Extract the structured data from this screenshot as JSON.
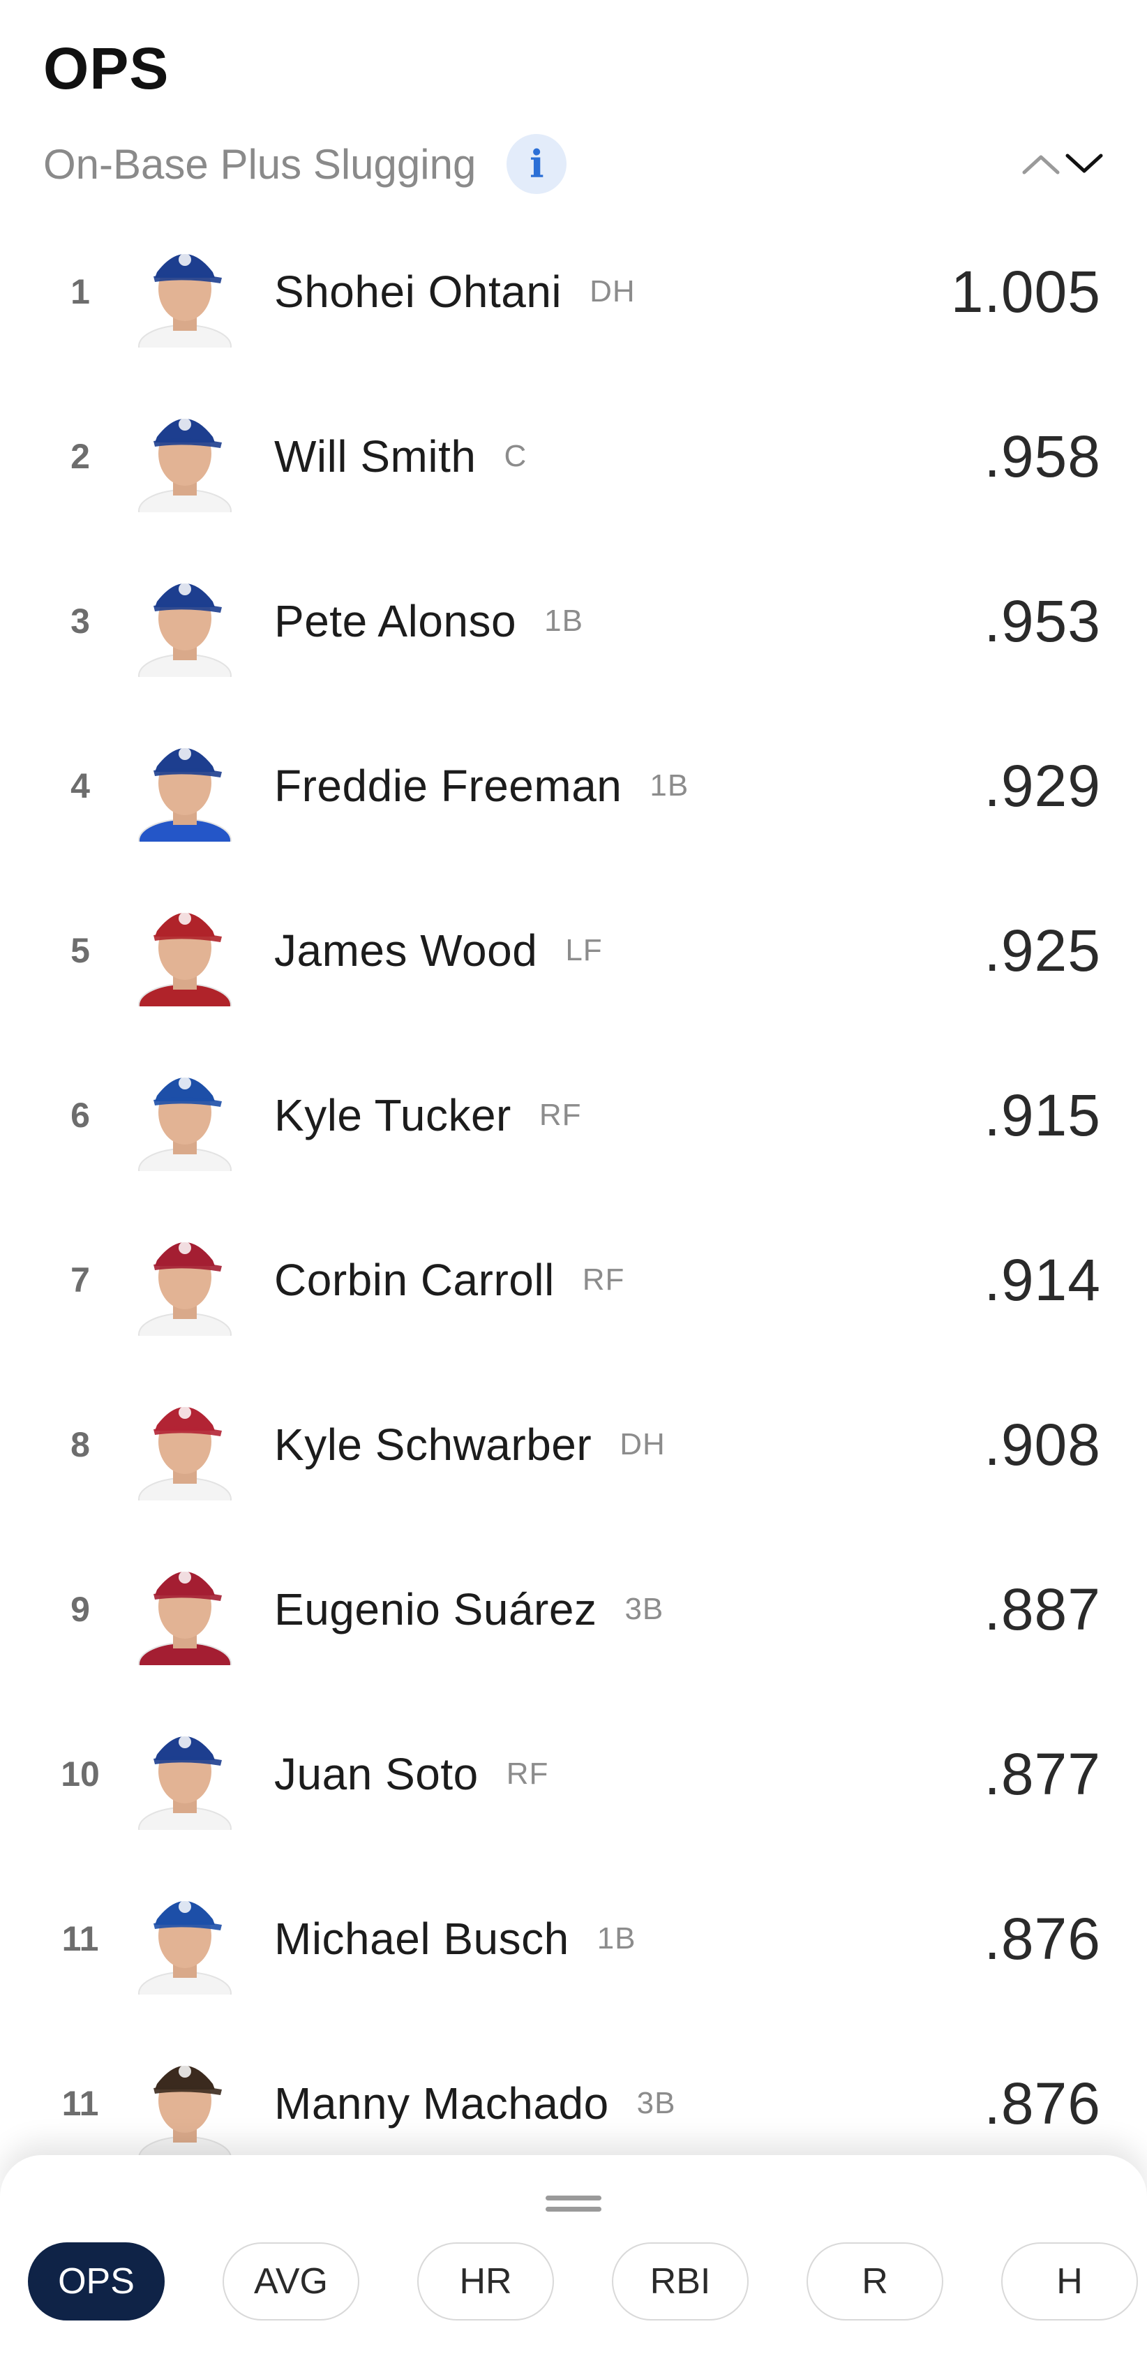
{
  "header": {
    "title": "OPS",
    "subtitle": "On-Base Plus Slugging",
    "info_icon": "info-icon",
    "sort_icons": [
      "chevron-up-icon",
      "chevron-down-icon"
    ]
  },
  "players": [
    {
      "rank": "1",
      "name": "Shohei Ohtani",
      "pos": "DH",
      "value": "1.005",
      "team_color": "#1d3e8f",
      "jersey_color": "#f4f4f4"
    },
    {
      "rank": "2",
      "name": "Will Smith",
      "pos": "C",
      "value": ".958",
      "team_color": "#1d3e8f",
      "jersey_color": "#f4f4f4"
    },
    {
      "rank": "3",
      "name": "Pete Alonso",
      "pos": "1B",
      "value": ".953",
      "team_color": "#1d3e8f",
      "jersey_color": "#f4f4f4"
    },
    {
      "rank": "4",
      "name": "Freddie Freeman",
      "pos": "1B",
      "value": ".929",
      "team_color": "#1d3e8f",
      "jersey_color": "#2456c8"
    },
    {
      "rank": "5",
      "name": "James Wood",
      "pos": "LF",
      "value": ".925",
      "team_color": "#b0232a",
      "jersey_color": "#b0232a"
    },
    {
      "rank": "6",
      "name": "Kyle Tucker",
      "pos": "RF",
      "value": ".915",
      "team_color": "#1d4fa8",
      "jersey_color": "#f4f4f4"
    },
    {
      "rank": "7",
      "name": "Corbin Carroll",
      "pos": "RF",
      "value": ".914",
      "team_color": "#a41e32",
      "jersey_color": "#f4f4f4"
    },
    {
      "rank": "8",
      "name": "Kyle Schwarber",
      "pos": "DH",
      "value": ".908",
      "team_color": "#b22434",
      "jersey_color": "#f4f4f4"
    },
    {
      "rank": "9",
      "name": "Eugenio Suárez",
      "pos": "3B",
      "value": ".887",
      "team_color": "#a41e32",
      "jersey_color": "#a41e32"
    },
    {
      "rank": "10",
      "name": "Juan Soto",
      "pos": "RF",
      "value": ".877",
      "team_color": "#1d3e8f",
      "jersey_color": "#f4f4f4"
    },
    {
      "rank": "11",
      "name": "Michael Busch",
      "pos": "1B",
      "value": ".876",
      "team_color": "#1d4fa8",
      "jersey_color": "#f4f4f4"
    },
    {
      "rank": "11",
      "name": "Manny Machado",
      "pos": "3B",
      "value": ".876",
      "team_color": "#3b2a1e",
      "jersey_color": "#f4f4f4"
    }
  ],
  "stat_tabs": [
    {
      "label": "OPS",
      "active": true
    },
    {
      "label": "AVG",
      "active": false
    },
    {
      "label": "HR",
      "active": false
    },
    {
      "label": "RBI",
      "active": false
    },
    {
      "label": "R",
      "active": false
    },
    {
      "label": "H",
      "active": false
    }
  ],
  "colors": {
    "accent": "#0f2347",
    "info_blue": "#2b6fd6",
    "muted_text": "#8a8a8a"
  }
}
